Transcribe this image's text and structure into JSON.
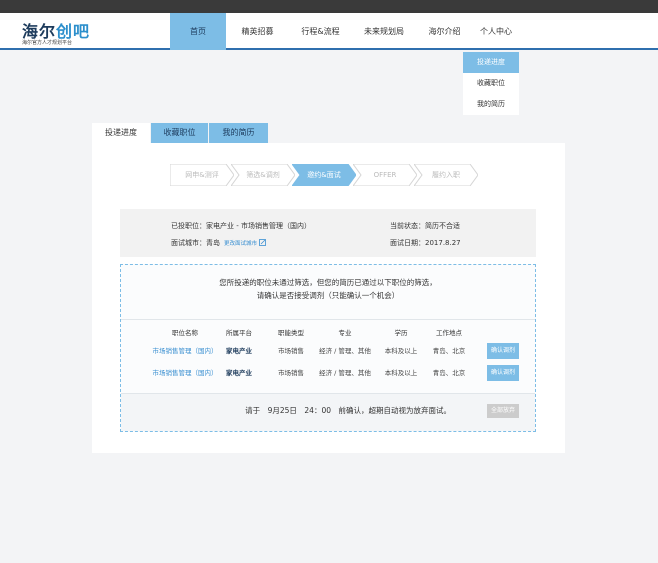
{
  "brand": {
    "logo_main_prefix": "海尔",
    "logo_main_accent": "创吧",
    "logo_sub": "海尔官方人才规划平台"
  },
  "nav": {
    "items": [
      {
        "label": "首页"
      },
      {
        "label": "精英招募"
      },
      {
        "label": "行程&流程"
      },
      {
        "label": "未来规划局"
      },
      {
        "label": "海尔介绍"
      },
      {
        "label": "个人中心"
      }
    ],
    "active_index": 0
  },
  "user_menu": {
    "items": [
      {
        "label": "投递进度"
      },
      {
        "label": "收藏职位"
      },
      {
        "label": "我的简历"
      }
    ],
    "active_index": 0
  },
  "tabs": [
    {
      "label": "投递进度"
    },
    {
      "label": "收藏职位"
    },
    {
      "label": "我的简历"
    }
  ],
  "steps": [
    {
      "label": "网申&测评"
    },
    {
      "label": "筛选&调剂"
    },
    {
      "label": "邀约&面试"
    },
    {
      "label": "OFFER"
    },
    {
      "label": "履约入职"
    }
  ],
  "steps_active_index": 2,
  "application": {
    "position_label": "已投职位：",
    "position_value": "家电产业 - 市场销售管理（国内）",
    "status_label": "当前状态：",
    "status_value": "简历不合适",
    "city_label": "面试城市：",
    "city_value": "青岛",
    "city_change_link": "更改面试城市",
    "date_label": "面试日期：",
    "date_value": "2017.8.27"
  },
  "reassign": {
    "message_line1": "您所投递的职位未通过筛选，但您的简历已通过以下职位的筛选，",
    "message_line2": "请确认是否接受调剂（只能确认一个机会）",
    "columns": [
      "职位名称",
      "所属平台",
      "职能类型",
      "专业",
      "学历",
      "工作地点"
    ],
    "rows": [
      {
        "position": "市场销售管理（国内）",
        "platform": "家电产业",
        "function": "市场销售",
        "major": "经济 / 管理、其他",
        "education": "本科及以上",
        "location": "青岛、北京",
        "action": "确认调剂"
      },
      {
        "position": "市场销售管理（国内）",
        "platform": "家电产业",
        "function": "市场销售",
        "major": "经济 / 管理、其他",
        "education": "本科及以上",
        "location": "青岛、北京",
        "action": "确认调剂"
      }
    ],
    "deadline_text": "请于　9月25日　24：00　前确认，超期自动视为放弃面试。",
    "give_up_label": "全部放弃"
  },
  "colors": {
    "accent": "#7dbde6",
    "brand_dark": "#1d3b5c",
    "link": "#3a8fd1",
    "topbar": "#3a3a3a"
  }
}
